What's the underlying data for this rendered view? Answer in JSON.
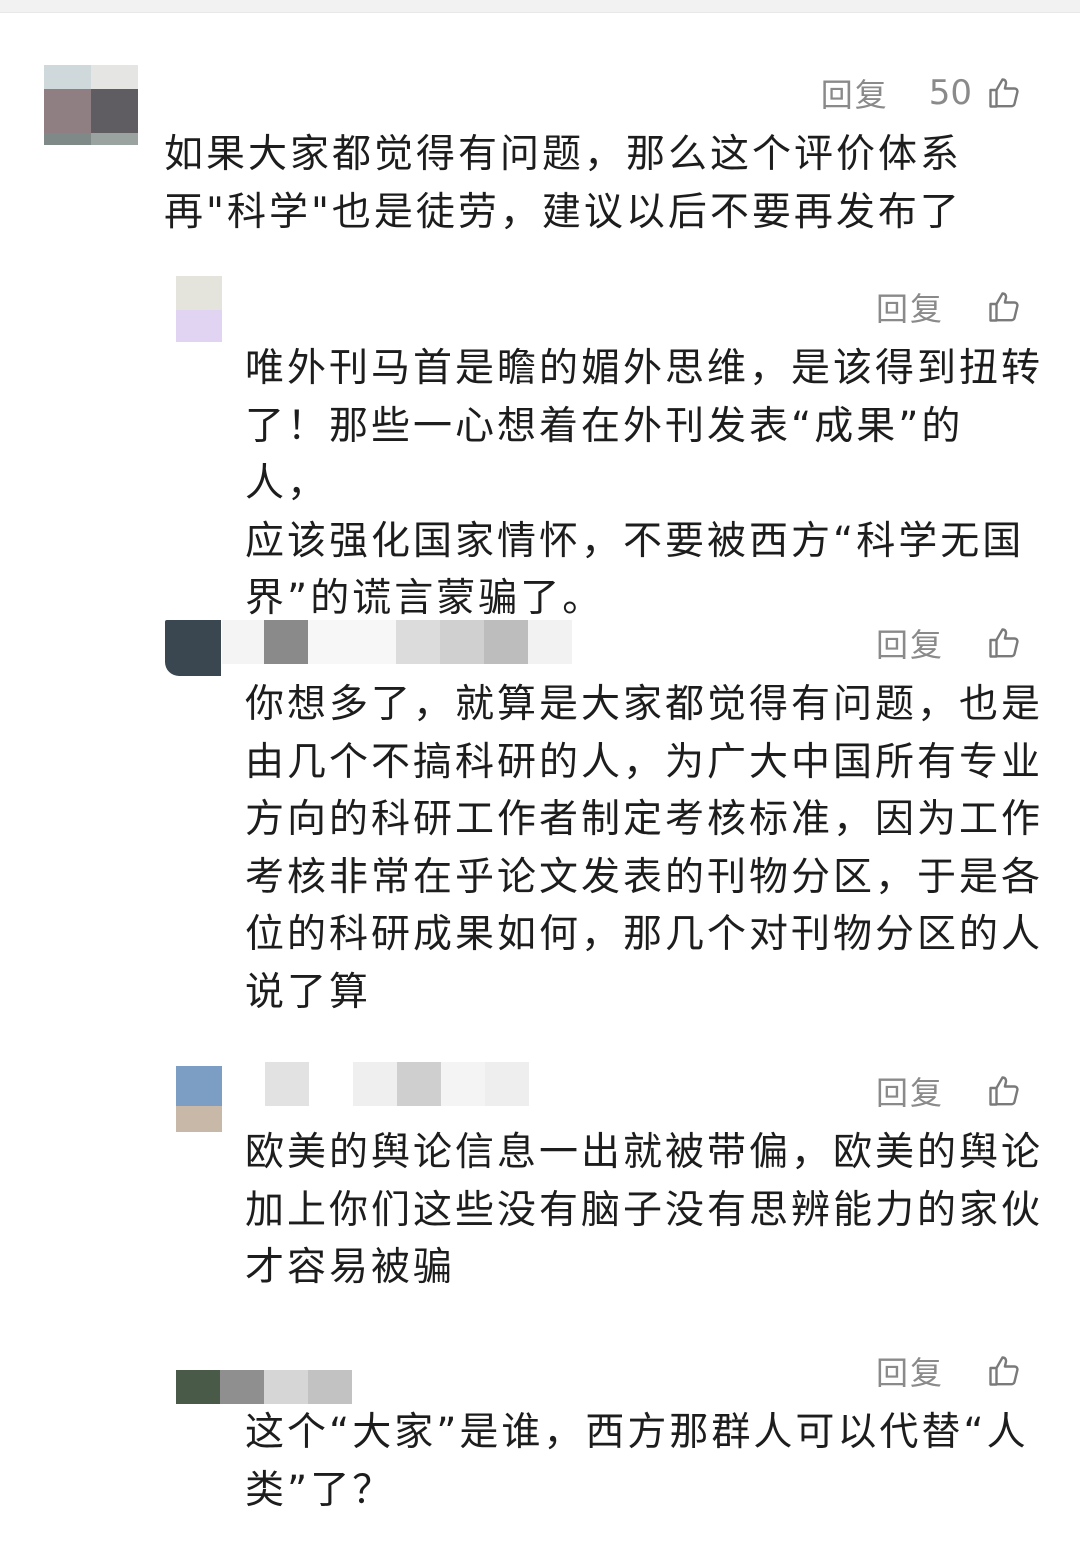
{
  "comments": [
    {
      "reply_label": "回复",
      "like_count": "50",
      "text": "如果大家都觉得有问题，那么这个评价体系\n再\"科学\"也是徒劳，建议以后不要再发布了",
      "avatar_icon": "avatar-blurred",
      "like_icon": "thumbs-up-icon"
    },
    {
      "reply_label": "回复",
      "text": "唯外刊马首是瞻的媚外思维，是该得到扭转\n了！那些一心想着在外刊发表“成果”的人，\n应该强化国家情怀，不要被西方“科学无国\n界”的谎言蒙骗了。",
      "avatar_icon": "avatar-blurred",
      "like_icon": "thumbs-up-icon"
    },
    {
      "reply_label": "回复",
      "text": "你想多了，就算是大家都觉得有问题，也是\n由几个不搞科研的人，为广大中国所有专业\n方向的科研工作者制定考核标准，因为工作\n考核非常在乎论文发表的刊物分区，于是各\n位的科研成果如何，那几个对刊物分区的人\n说了算",
      "avatar_icon": "avatar-blurred",
      "like_icon": "thumbs-up-icon"
    },
    {
      "reply_label": "回复",
      "text": "欧美的舆论信息一出就被带偏，欧美的舆论\n加上你们这些没有脑子没有思辨能力的家伙\n才容易被骗",
      "avatar_icon": "avatar-blurred",
      "like_icon": "thumbs-up-icon"
    },
    {
      "reply_label": "回复",
      "text": "这个“大家”是谁，西方那群人可以代替“人\n类”了？",
      "avatar_icon": "avatar-blurred",
      "like_icon": "thumbs-up-icon"
    }
  ],
  "colors": {
    "text": "#1d1d1d",
    "meta": "#8a8a8a",
    "background": "#ffffff"
  }
}
